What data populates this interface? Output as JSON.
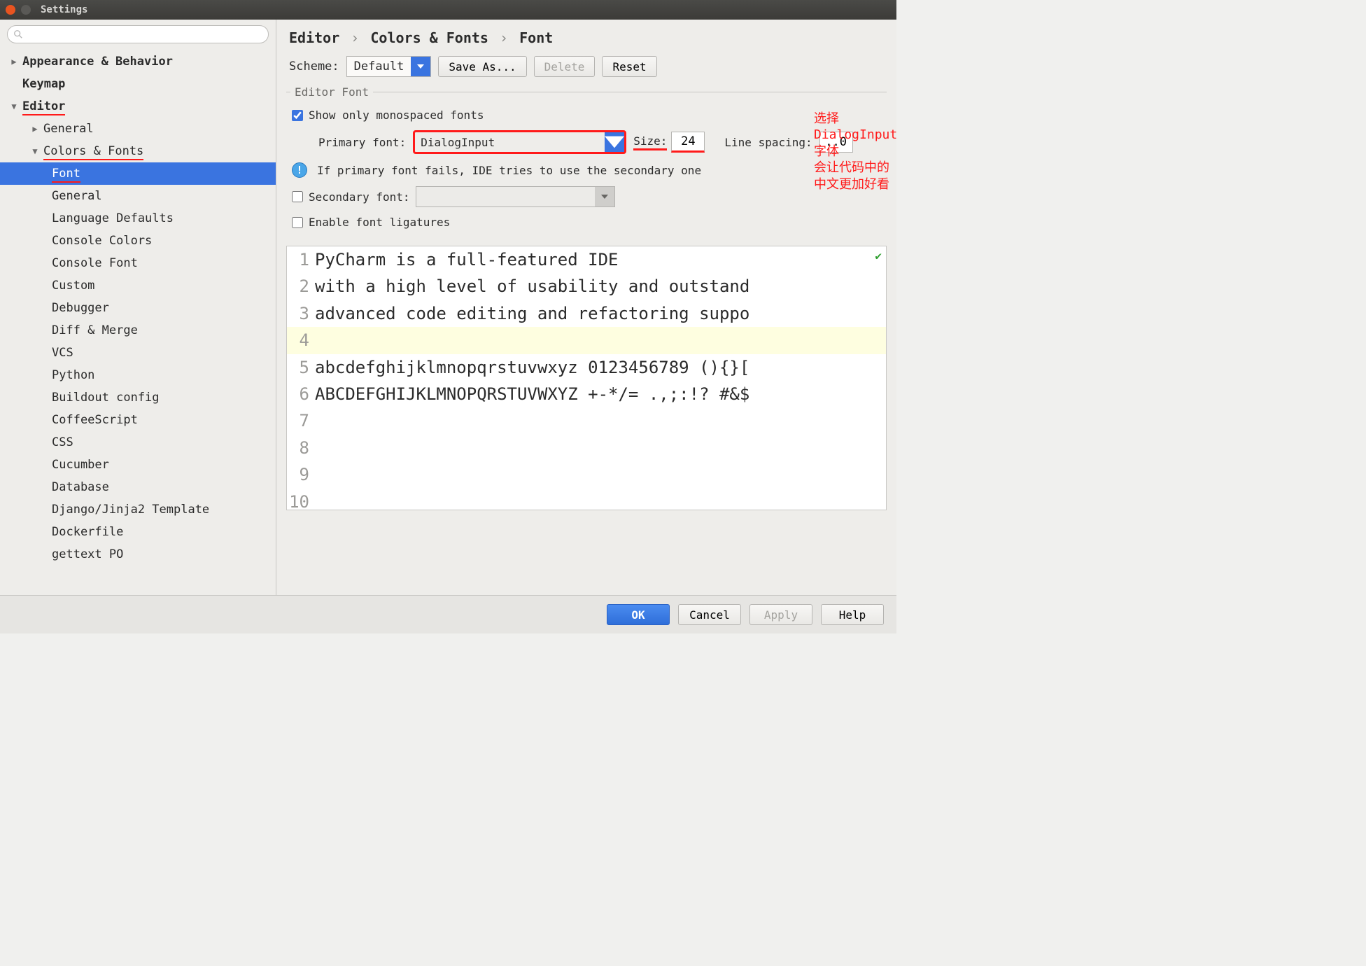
{
  "window": {
    "title": "Settings"
  },
  "sidebar": {
    "search_placeholder": "",
    "items": [
      {
        "label": "Appearance & Behavior",
        "level": 0,
        "exp": "closed",
        "bold": true
      },
      {
        "label": "Keymap",
        "level": 0,
        "exp": "",
        "bold": true
      },
      {
        "label": "Editor",
        "level": 0,
        "exp": "open",
        "bold": true,
        "redline": true
      },
      {
        "label": "General",
        "level": 1,
        "exp": "closed"
      },
      {
        "label": "Colors & Fonts",
        "level": 1,
        "exp": "open",
        "redline": true
      },
      {
        "label": "Font",
        "level": 2,
        "sel": true,
        "redline": true
      },
      {
        "label": "General",
        "level": 2
      },
      {
        "label": "Language Defaults",
        "level": 2
      },
      {
        "label": "Console Colors",
        "level": 2
      },
      {
        "label": "Console Font",
        "level": 2
      },
      {
        "label": "Custom",
        "level": 2
      },
      {
        "label": "Debugger",
        "level": 2
      },
      {
        "label": "Diff & Merge",
        "level": 2
      },
      {
        "label": "VCS",
        "level": 2
      },
      {
        "label": "Python",
        "level": 2
      },
      {
        "label": "Buildout config",
        "level": 2
      },
      {
        "label": "CoffeeScript",
        "level": 2
      },
      {
        "label": "CSS",
        "level": 2
      },
      {
        "label": "Cucumber",
        "level": 2
      },
      {
        "label": "Database",
        "level": 2
      },
      {
        "label": "Django/Jinja2 Template",
        "level": 2
      },
      {
        "label": "Dockerfile",
        "level": 2
      },
      {
        "label": "gettext PO",
        "level": 2
      }
    ]
  },
  "breadcrumb": {
    "a": "Editor",
    "b": "Colors & Fonts",
    "c": "Font"
  },
  "scheme": {
    "label": "Scheme:",
    "value": "Default",
    "save": "Save As...",
    "delete": "Delete",
    "reset": "Reset"
  },
  "editorFont": {
    "legend": "Editor Font",
    "mono": "Show only monospaced fonts",
    "primary_label": "Primary font:",
    "primary_value": "DialogInput",
    "size_label": "Size:",
    "size_value": "24",
    "spacing_label": "Line spacing:",
    "spacing_value": "..0",
    "hint": "If primary font fails, IDE tries to use the secondary one",
    "secondary_label": "Secondary font:",
    "ligatures": "Enable font ligatures"
  },
  "annotation": {
    "l1": "选择 DialogInput 字体",
    "l2": "会让代码中的中文更加好看"
  },
  "preview": {
    "lines": [
      "PyCharm is a full-featured IDE",
      "with a high level of usability and outstand",
      "advanced code editing and refactoring suppo",
      "",
      "abcdefghijklmnopqrstuvwxyz 0123456789 (){}[",
      "ABCDEFGHIJKLMNOPQRSTUVWXYZ +-*/= .,;:!? #&$",
      "",
      "",
      "",
      ""
    ]
  },
  "footer": {
    "ok": "OK",
    "cancel": "Cancel",
    "apply": "Apply",
    "help": "Help"
  }
}
